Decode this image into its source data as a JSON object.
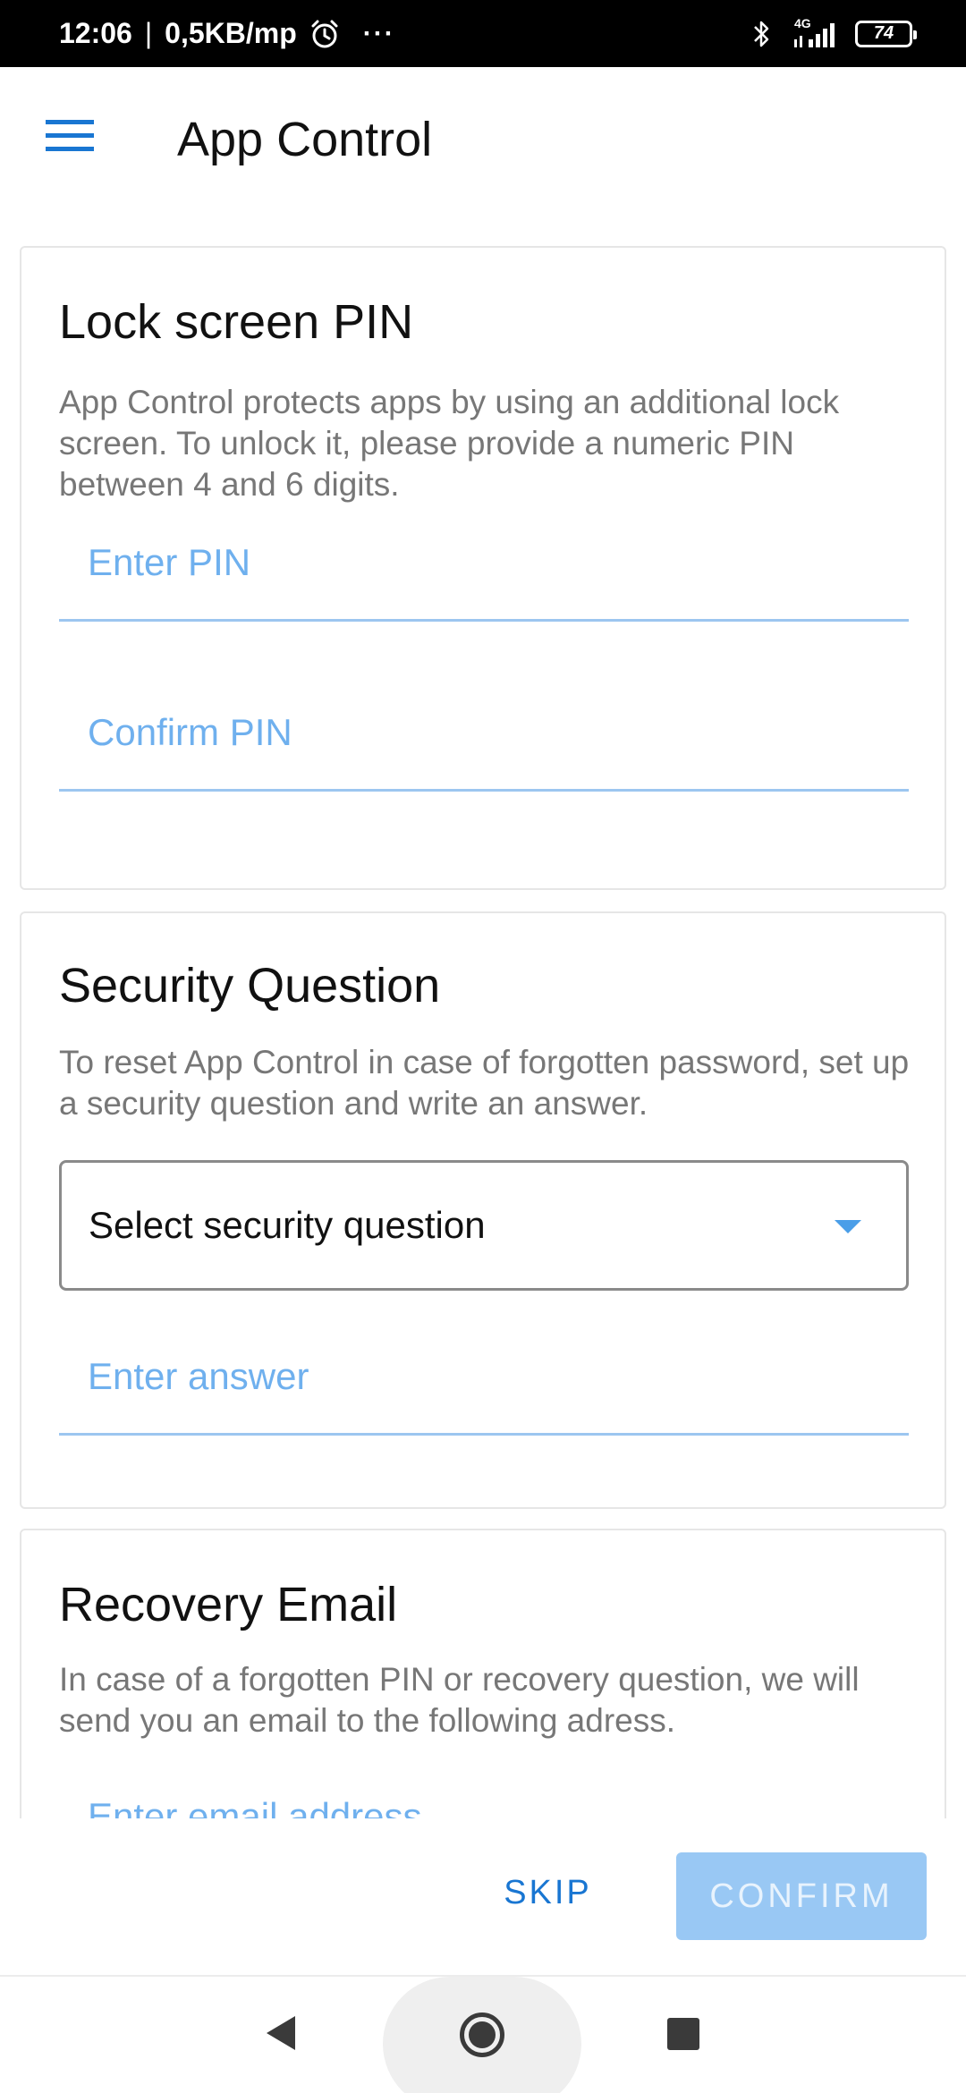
{
  "status_bar": {
    "time": "12:06",
    "separator": "|",
    "speed": "0,5KB/mp",
    "more": "···",
    "network": "4G",
    "battery": "74"
  },
  "app_bar": {
    "title": "App Control",
    "menu_icon": "hamburger-menu-icon"
  },
  "lock_pin": {
    "title": "Lock screen PIN",
    "description": "App Control protects apps by using an additional lock screen. To unlock it, please provide a numeric PIN between 4 and 6 digits.",
    "enter_pin_placeholder": "Enter PIN",
    "confirm_pin_placeholder": "Confirm PIN"
  },
  "security_question": {
    "title": "Security Question",
    "description": "To reset App Control in case of forgotten password, set up a security question and write an answer.",
    "select_placeholder": "Select security question",
    "answer_placeholder": "Enter answer"
  },
  "recovery_email": {
    "title": "Recovery Email",
    "description": "In case of a forgotten PIN or recovery question, we will send you an email to the following adress.",
    "email_placeholder": "Enter email address"
  },
  "actions": {
    "skip_label": "SKIP",
    "confirm_label": "CONFIRM"
  },
  "colors": {
    "accent": "#1976d2",
    "field_label": "#6fb0ee",
    "confirm_disabled_bg": "#99c8f4"
  }
}
